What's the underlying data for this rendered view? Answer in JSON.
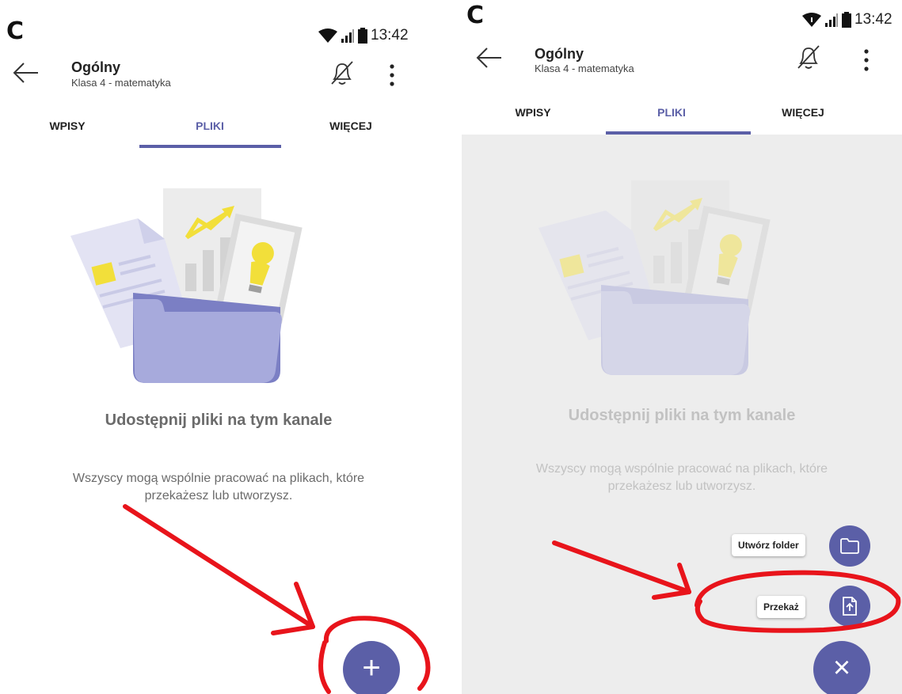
{
  "status": {
    "logo": "C",
    "time": "13:42"
  },
  "header": {
    "title": "Ogólny",
    "subtitle": "Klasa 4 - matematyka"
  },
  "tabs": [
    {
      "label": "WPISY"
    },
    {
      "label": "PLIKI"
    },
    {
      "label": "WIĘCEJ"
    }
  ],
  "empty_state": {
    "headline": "Udostępnij pliki na tym kanale",
    "description_line1": "Wszyscy mogą wspólnie pracować na plikach, które",
    "description_line2": "przekażesz lub utworzysz."
  },
  "fab": {
    "add_glyph": "+",
    "close_glyph": "×"
  },
  "fab_menu": [
    {
      "label": "Utwórz folder",
      "icon": "folder-icon"
    },
    {
      "label": "Przekaż",
      "icon": "upload-file-icon"
    }
  ],
  "colors": {
    "accent": "#5b5fa7",
    "annotation": "#e8141b"
  }
}
